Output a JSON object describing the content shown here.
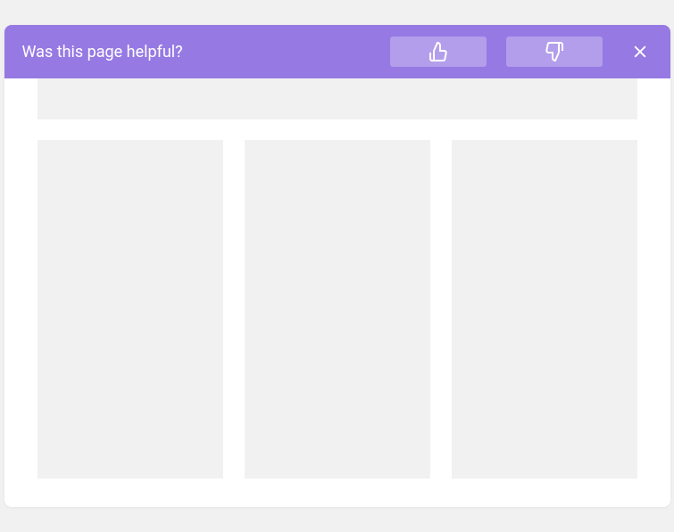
{
  "feedback": {
    "question": "Was this page helpful?"
  }
}
